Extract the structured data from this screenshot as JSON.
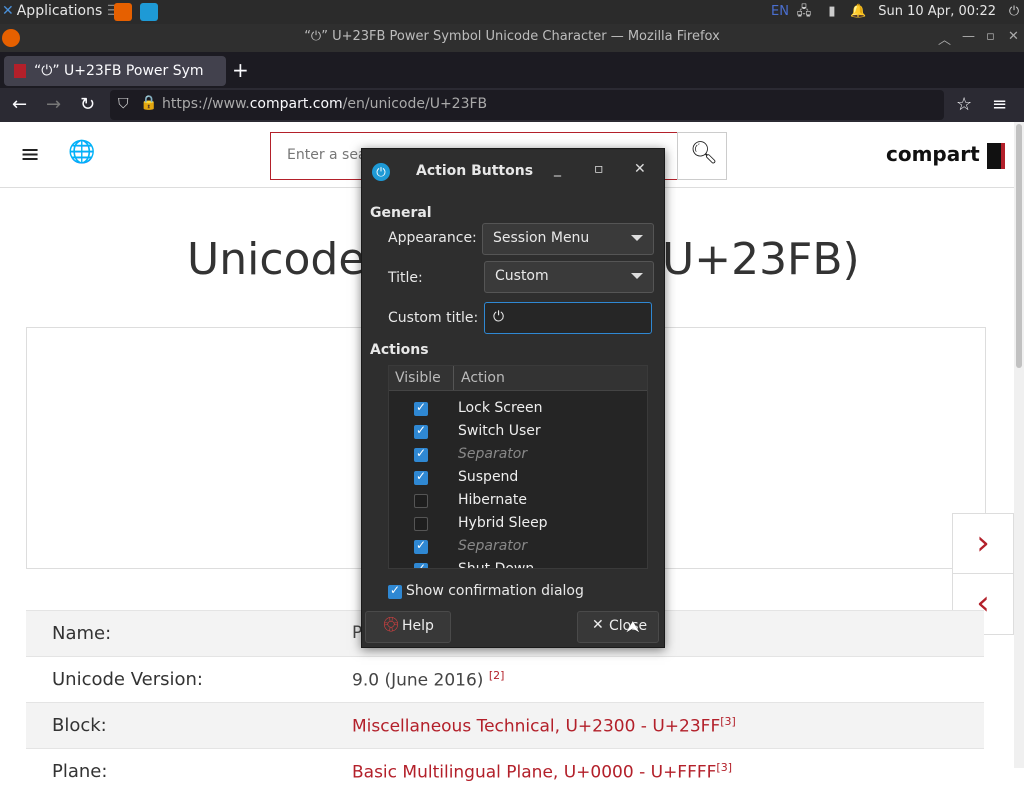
{
  "panel": {
    "app_label": "Applications",
    "app_suffix": "☰",
    "clock": "Sun 10 Apr, 00:22",
    "lang": "EN"
  },
  "window": {
    "title": "“⏻” U+23FB Power Symbol Unicode Character — Mozilla Firefox"
  },
  "tab": {
    "label": "“⏻” U+23FB Power Sym"
  },
  "url": {
    "prefix": "https://www.",
    "domain": "compart.com",
    "path": "/en/unicode/U+23FB"
  },
  "site": {
    "search_placeholder": "Enter a sea",
    "logo": "compart",
    "heading_left": "Unicode",
    "heading_right": "U+23FB)",
    "rows": [
      {
        "key": "Name:",
        "value": "P"
      },
      {
        "key": "Unicode Version:",
        "value": "9.0 (June 2016)",
        "ref": "[2]"
      },
      {
        "key": "Block:",
        "value": "Miscellaneous Technical, U+2300 - U+23FF",
        "ref": "[3]"
      },
      {
        "key": "Plane:",
        "value": "Basic Multilingual Plane, U+0000 - U+FFFF",
        "ref": "[3]"
      }
    ]
  },
  "dialog": {
    "title": "Action Buttons",
    "general_label": "General",
    "appearance_label": "Appearance:",
    "appearance_value": "Session Menu",
    "title_label": "Title:",
    "title_value": "Custom",
    "custom_title_label": "Custom title:",
    "custom_title_value": "⏻",
    "actions_label": "Actions",
    "col_visible": "Visible",
    "col_action": "Action",
    "actions": [
      {
        "label": "Lock Screen",
        "visible": true,
        "separator": false
      },
      {
        "label": "Switch User",
        "visible": true,
        "separator": false
      },
      {
        "label": "Separator",
        "visible": true,
        "separator": true
      },
      {
        "label": "Suspend",
        "visible": true,
        "separator": false
      },
      {
        "label": "Hibernate",
        "visible": false,
        "separator": false
      },
      {
        "label": "Hybrid Sleep",
        "visible": false,
        "separator": false
      },
      {
        "label": "Separator",
        "visible": true,
        "separator": true
      },
      {
        "label": "Shut Down",
        "visible": true,
        "separator": false
      }
    ],
    "confirm_label": "Show confirmation dialog",
    "confirm_checked": true,
    "help_label": "Help",
    "close_label": "Close"
  },
  "colors": {
    "accent": "#2f88d3",
    "brand": "#b3202a",
    "dialog_bg": "#2e2e2e"
  }
}
